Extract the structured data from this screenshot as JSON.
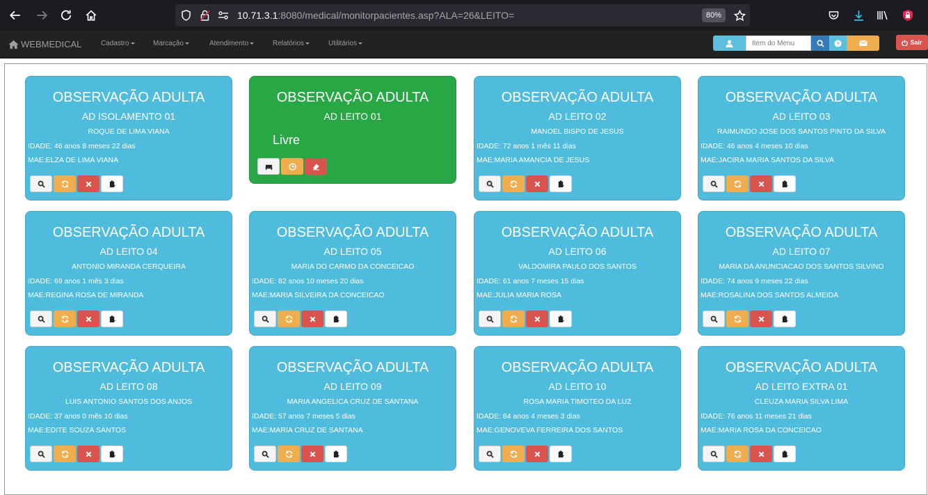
{
  "browser": {
    "url_host": "10.71.3.1",
    "url_rest": ":8080/medical/monitorpacientes.asp?ALA=26&LEITO=",
    "zoom": "80%"
  },
  "navbar": {
    "brand": "WEBMEDICAL",
    "menus": [
      "Cadastro",
      "Marcação",
      "Atendimento",
      "Relatórios",
      "Utilitários"
    ],
    "search_placeholder": "Item do Menu",
    "exit_label": "Sair"
  },
  "cards": [
    {
      "ward": "OBSERVAÇÃO ADULTA",
      "bed": "AD ISOLAMENTO 01",
      "patient": "ROQUE DE LIMA VIANA",
      "age": "IDADE: 46 anos 8 meses 22 dias",
      "mother": "MAE:ELZA DE LIMA VIANA",
      "status": "occupied"
    },
    {
      "ward": "OBSERVAÇÃO ADULTA",
      "bed": "AD LEITO 01",
      "patient": "",
      "age": "",
      "mother": "",
      "status": "free",
      "free_label": "Livre"
    },
    {
      "ward": "OBSERVAÇÃO ADULTA",
      "bed": "AD LEITO 02",
      "patient": "MANOEL BISPO DE JESUS",
      "age": "IDADE: 72 anos 1 mês 11 dias",
      "mother": "MAE:MARIA AMANCIA DE JESUS",
      "status": "occupied"
    },
    {
      "ward": "OBSERVAÇÃO ADULTA",
      "bed": "AD LEITO 03",
      "patient": "RAIMUNDO JOSE DOS SANTOS PINTO DA SILVA",
      "age": "IDADE: 46 anos 4 meses 10 dias",
      "mother": "MAE:JACIRA MARIA SANTOS DA SILVA",
      "status": "occupied"
    },
    {
      "ward": "OBSERVAÇÃO ADULTA",
      "bed": "AD LEITO 04",
      "patient": "ANTONIO MIRANDA CERQUEIRA",
      "age": "IDADE: 69 anos 1 mês 3 dias",
      "mother": "MAE:REGINA ROSA DE MIRANDA",
      "status": "occupied"
    },
    {
      "ward": "OBSERVAÇÃO ADULTA",
      "bed": "AD LEITO 05",
      "patient": "MARIA DO CARMO DA CONCEICAO",
      "age": "IDADE: 82 anos 10 meses 20 dias",
      "mother": "MAE:MARIA SILVEIRA DA CONCEICAO",
      "status": "occupied"
    },
    {
      "ward": "OBSERVAÇÃO ADULTA",
      "bed": "AD LEITO 06",
      "patient": "VALDOMIRA PAULO DOS SANTOS",
      "age": "IDADE: 61 anos 7 meses 15 dias",
      "mother": "MAE:JULIA MARIA ROSA",
      "status": "occupied"
    },
    {
      "ward": "OBSERVAÇÃO ADULTA",
      "bed": "AD LEITO 07",
      "patient": "MARIA DA ANUNCIACAO DOS SANTOS SILVINO",
      "age": "IDADE: 74 anos 9 meses 22 dias",
      "mother": "MAE:ROSALINA DOS SANTOS ALMEIDA",
      "status": "occupied"
    },
    {
      "ward": "OBSERVAÇÃO ADULTA",
      "bed": "AD LEITO 08",
      "patient": "LUIS ANTONIO SANTOS DOS ANJOS",
      "age": "IDADE: 37 anos 0 mês 10 dias",
      "mother": "MAE:EDITE SOUZA SANTOS",
      "status": "occupied"
    },
    {
      "ward": "OBSERVAÇÃO ADULTA",
      "bed": "AD LEITO 09",
      "patient": "MARIA ANGELICA CRUZ DE SANTANA",
      "age": "IDADE: 57 anos 7 meses 5 dias",
      "mother": "MAE:MARIA CRUZ DE SANTANA",
      "status": "occupied"
    },
    {
      "ward": "OBSERVAÇÃO ADULTA",
      "bed": "AD LEITO 10",
      "patient": "ROSA MARIA TIMOTEO DA LUZ",
      "age": "IDADE: 84 anos 4 meses 3 dias",
      "mother": "MAE:GENOVEVA FERREIRA DOS SANTOS",
      "status": "occupied"
    },
    {
      "ward": "OBSERVAÇÃO ADULTA",
      "bed": "AD LEITO EXTRA 01",
      "patient": "CLEUZA MARIA SILVA LIMA",
      "age": "IDADE: 76 anos 11 meses 21 dias",
      "mother": "MAE:MARIA ROSA DA CONCEICAO",
      "status": "occupied"
    }
  ],
  "colors": {
    "occupied": "#4fbcdd",
    "free": "#28a745",
    "warning": "#f0ad4e",
    "danger": "#d9534f",
    "primary": "#337ab7"
  }
}
